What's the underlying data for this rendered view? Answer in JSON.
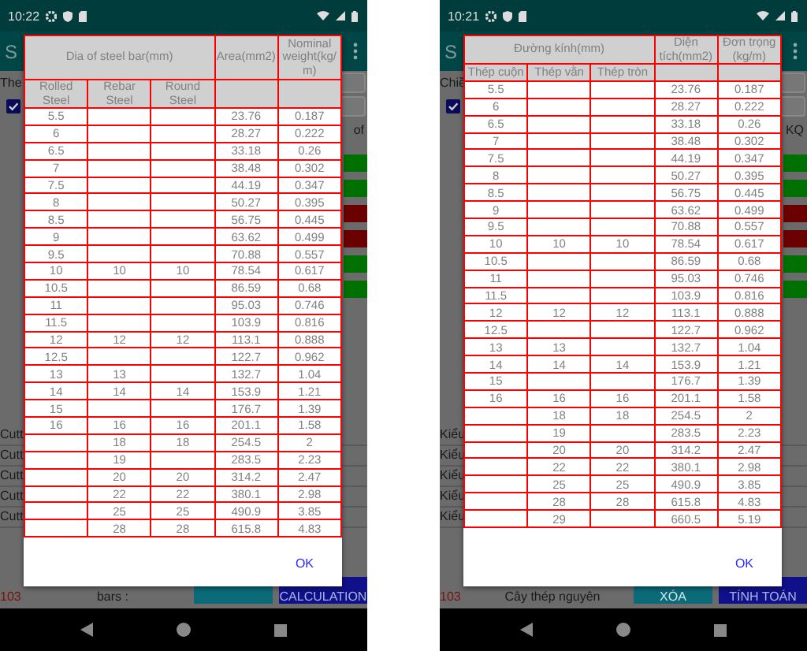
{
  "phones": [
    {
      "status_time": "10:22",
      "app_title": "S",
      "background": {
        "top_label": "The",
        "checkbox": {
          "checked": true
        },
        "right_label": "of",
        "side_buttons": [
          {
            "color": "#007000"
          },
          {
            "color": "#007000"
          },
          {
            "color": "#6a0000"
          },
          {
            "color": "#6a0000"
          },
          {
            "color": "#007000"
          },
          {
            "color": "#007000"
          }
        ],
        "list_labels": [
          "Cutt",
          "Cutt",
          "Cutt",
          "Cutt",
          "Cutt"
        ],
        "count": "103",
        "bottom_label": "bars :",
        "buttons": [
          {
            "color": "#0b6a78"
          },
          {
            "color": "#10108a",
            "label": "CALCULATION"
          }
        ]
      },
      "dialog": {
        "group_header": "Dia of steel bar(mm)",
        "sub_headers": [
          "Rolled Steel",
          "Rebar Steel",
          "Round Steel"
        ],
        "area_header": "Area(mm2)",
        "weight_header": "Nominal weight(kg/m)",
        "ok": "OK",
        "rows": [
          [
            "5.5",
            null,
            null,
            "23.76",
            "0.187"
          ],
          [
            "6",
            null,
            null,
            "28.27",
            "0.222"
          ],
          [
            "6.5",
            null,
            null,
            "33.18",
            "0.26"
          ],
          [
            "7",
            null,
            null,
            "38.48",
            "0.302"
          ],
          [
            "7.5",
            null,
            null,
            "44.19",
            "0.347"
          ],
          [
            "8",
            null,
            null,
            "50.27",
            "0.395"
          ],
          [
            "8.5",
            null,
            null,
            "56.75",
            "0.445"
          ],
          [
            "9",
            null,
            null,
            "63.62",
            "0.499"
          ],
          [
            "9.5",
            null,
            null,
            "70.88",
            "0.557"
          ],
          [
            "10",
            "10",
            "10",
            "78.54",
            "0.617"
          ],
          [
            "10.5",
            null,
            null,
            "86.59",
            "0.68"
          ],
          [
            "11",
            null,
            null,
            "95.03",
            "0.746"
          ],
          [
            "11.5",
            null,
            null,
            "103.9",
            "0.816"
          ],
          [
            "12",
            "12",
            "12",
            "113.1",
            "0.888"
          ],
          [
            "12.5",
            null,
            null,
            "122.7",
            "0.962"
          ],
          [
            "13",
            "13",
            null,
            "132.7",
            "1.04"
          ],
          [
            "14",
            "14",
            "14",
            "153.9",
            "1.21"
          ],
          [
            "15",
            null,
            null,
            "176.7",
            "1.39"
          ],
          [
            "16",
            "16",
            "16",
            "201.1",
            "1.58"
          ],
          [
            null,
            "18",
            "18",
            "254.5",
            "2"
          ],
          [
            null,
            "19",
            null,
            "283.5",
            "2.23"
          ],
          [
            null,
            "20",
            "20",
            "314.2",
            "2.47"
          ],
          [
            null,
            "22",
            "22",
            "380.1",
            "2.98"
          ],
          [
            null,
            "25",
            "25",
            "490.9",
            "3.85"
          ],
          [
            null,
            "28",
            "28",
            "615.8",
            "4.83"
          ]
        ]
      }
    },
    {
      "status_time": "10:21",
      "app_title": "S",
      "background": {
        "top_label": "Chiề",
        "checkbox": {
          "checked": true
        },
        "right_label": "KQ",
        "side_buttons": [
          {
            "color": "#007000"
          },
          {
            "color": "#007000"
          },
          {
            "color": "#6a0000"
          },
          {
            "color": "#6a0000"
          },
          {
            "color": "#007000"
          },
          {
            "color": "#007000"
          }
        ],
        "list_labels": [
          "Kiểu",
          "Kiểu",
          "Kiểu",
          "Kiểu",
          "Kiểu"
        ],
        "count": "103",
        "bottom_label": "Cây thép nguyên",
        "buttons": [
          {
            "color": "#0b6a78",
            "label": "XÓA"
          },
          {
            "color": "#10108a",
            "label": "TÍNH TOÁN"
          }
        ]
      },
      "dialog": {
        "group_header": "Đường kính(mm)",
        "sub_headers": [
          "Thép cuộn",
          "Thép vằn",
          "Thép tròn"
        ],
        "area_header": "Diện tích(mm2)",
        "weight_header": "Đơn trọng (kg/m)",
        "ok": "OK",
        "rows": [
          [
            "5.5",
            null,
            null,
            "23.76",
            "0.187"
          ],
          [
            "6",
            null,
            null,
            "28.27",
            "0.222"
          ],
          [
            "6.5",
            null,
            null,
            "33.18",
            "0.26"
          ],
          [
            "7",
            null,
            null,
            "38.48",
            "0.302"
          ],
          [
            "7.5",
            null,
            null,
            "44.19",
            "0.347"
          ],
          [
            "8",
            null,
            null,
            "50.27",
            "0.395"
          ],
          [
            "8.5",
            null,
            null,
            "56.75",
            "0.445"
          ],
          [
            "9",
            null,
            null,
            "63.62",
            "0.499"
          ],
          [
            "9.5",
            null,
            null,
            "70.88",
            "0.557"
          ],
          [
            "10",
            "10",
            "10",
            "78.54",
            "0.617"
          ],
          [
            "10.5",
            null,
            null,
            "86.59",
            "0.68"
          ],
          [
            "11",
            null,
            null,
            "95.03",
            "0.746"
          ],
          [
            "11.5",
            null,
            null,
            "103.9",
            "0.816"
          ],
          [
            "12",
            "12",
            "12",
            "113.1",
            "0.888"
          ],
          [
            "12.5",
            null,
            null,
            "122.7",
            "0.962"
          ],
          [
            "13",
            "13",
            null,
            "132.7",
            "1.04"
          ],
          [
            "14",
            "14",
            "14",
            "153.9",
            "1.21"
          ],
          [
            "15",
            null,
            null,
            "176.7",
            "1.39"
          ],
          [
            "16",
            "16",
            "16",
            "201.1",
            "1.58"
          ],
          [
            null,
            "18",
            "18",
            "254.5",
            "2"
          ],
          [
            null,
            "19",
            null,
            "283.5",
            "2.23"
          ],
          [
            null,
            "20",
            "20",
            "314.2",
            "2.47"
          ],
          [
            null,
            "22",
            "22",
            "380.1",
            "2.98"
          ],
          [
            null,
            "25",
            "25",
            "490.9",
            "3.85"
          ],
          [
            null,
            "28",
            "28",
            "615.8",
            "4.83"
          ],
          [
            null,
            "29",
            null,
            "660.5",
            "5.19"
          ]
        ]
      }
    }
  ]
}
